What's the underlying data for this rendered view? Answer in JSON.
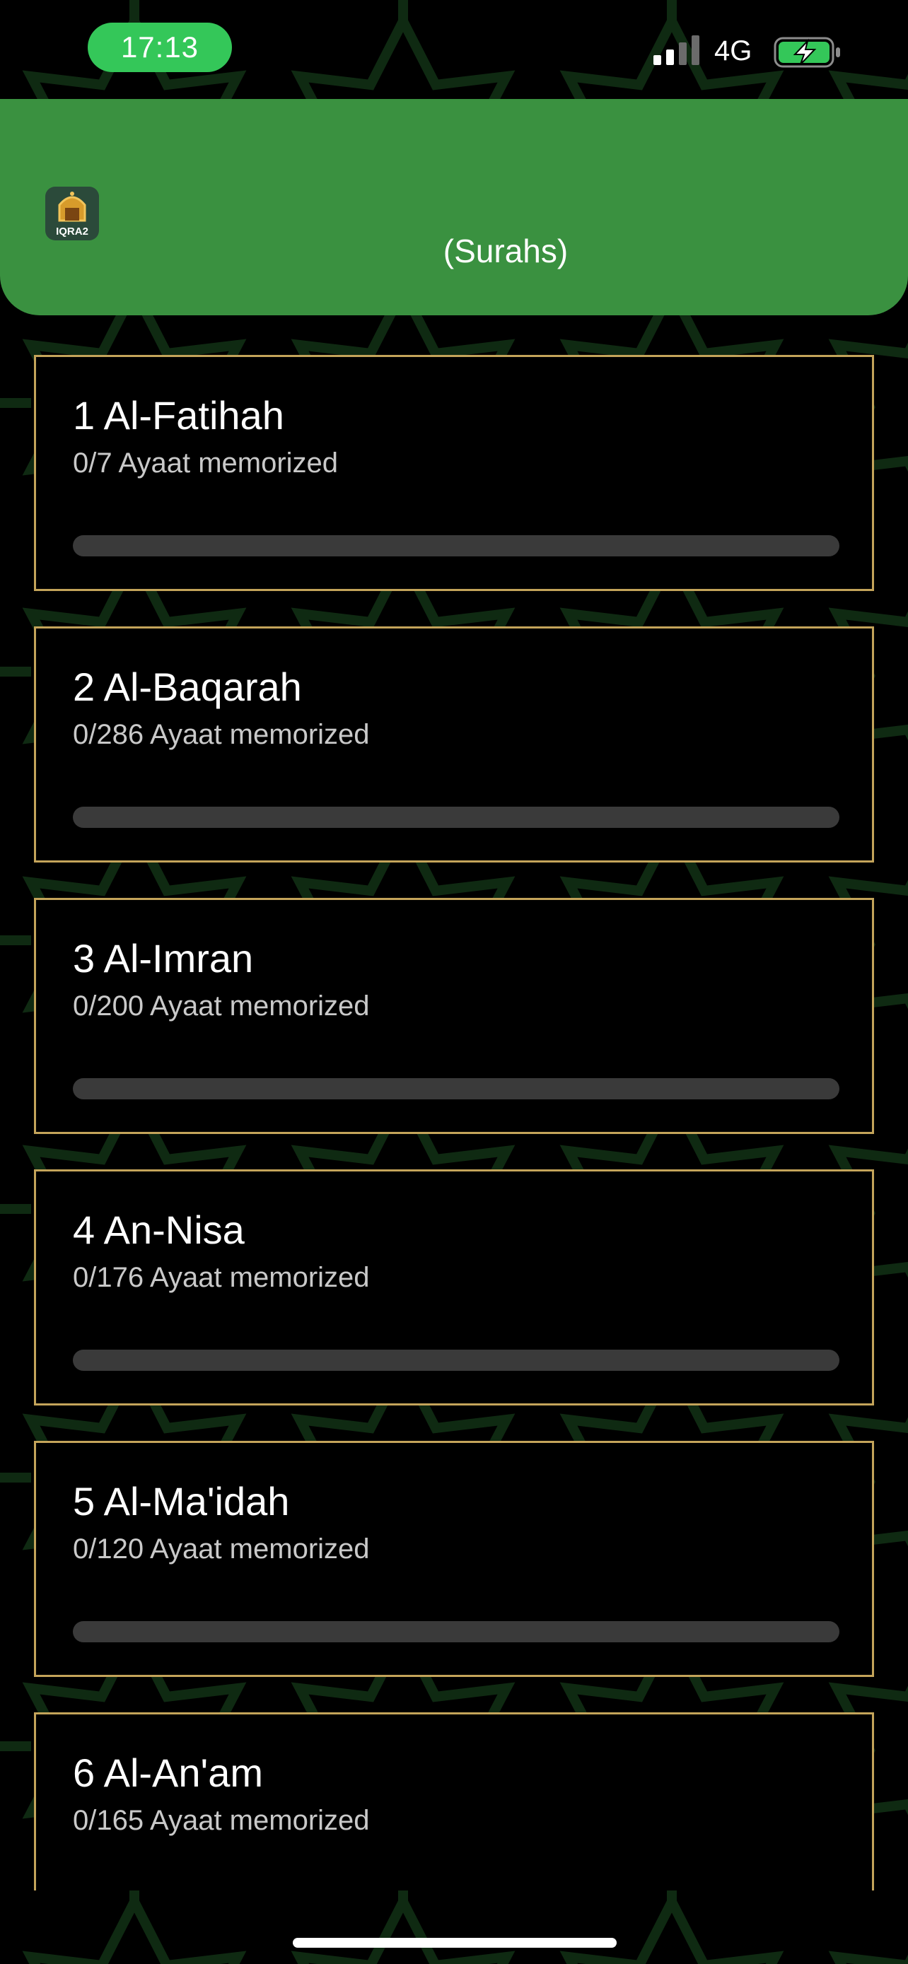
{
  "status_bar": {
    "time": "17:13",
    "network": "4G",
    "signal_icon": "cellular-signal-icon",
    "battery_icon": "battery-charging-icon"
  },
  "header": {
    "logo_text": "IQRA2",
    "title": "(Surahs)",
    "background_color": "#3a9140"
  },
  "colors": {
    "card_border": "#c4a45a",
    "progress_track": "#3a3a3a",
    "status_pill": "#34c759"
  },
  "surahs": [
    {
      "title": "1 Al-Fatihah",
      "subtitle": "0/7 Ayaat memorized",
      "progress": 0
    },
    {
      "title": "2 Al-Baqarah",
      "subtitle": "0/286 Ayaat memorized",
      "progress": 0
    },
    {
      "title": "3 Al-Imran",
      "subtitle": "0/200 Ayaat memorized",
      "progress": 0
    },
    {
      "title": "4 An-Nisa",
      "subtitle": "0/176 Ayaat memorized",
      "progress": 0
    },
    {
      "title": "5 Al-Ma'idah",
      "subtitle": "0/120 Ayaat memorized",
      "progress": 0
    },
    {
      "title": "6 Al-An'am",
      "subtitle": "0/165 Ayaat memorized",
      "progress": 0
    }
  ]
}
